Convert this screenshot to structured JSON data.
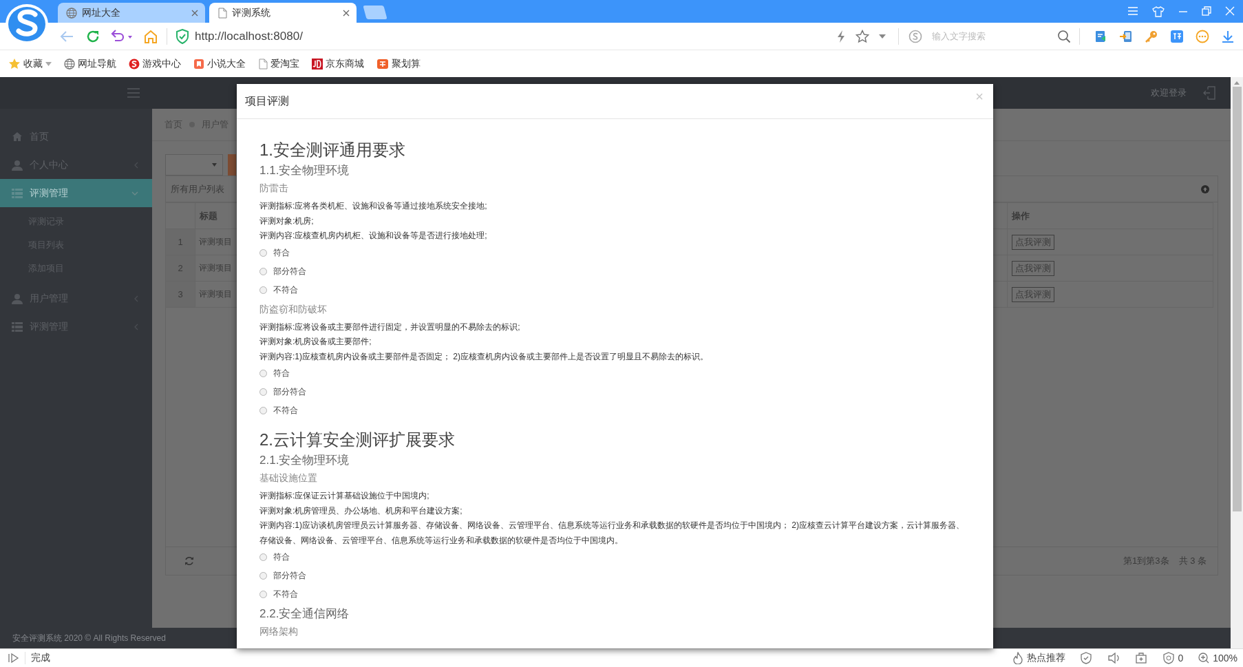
{
  "browser": {
    "tabs": [
      {
        "label": "网址大全",
        "selected": false
      },
      {
        "label": "评测系统",
        "selected": true
      }
    ],
    "address": "http://localhost:8080/",
    "search": {
      "placeholder": "输入文字搜索"
    },
    "bookmarks": [
      {
        "label": "收藏",
        "kind": "favorites"
      },
      {
        "label": "网址导航",
        "kind": "globe"
      },
      {
        "label": "游戏中心",
        "kind": "game"
      },
      {
        "label": "小说大全",
        "kind": "novel"
      },
      {
        "label": "爱淘宝",
        "kind": "page"
      },
      {
        "label": "京东商城",
        "kind": "shop"
      },
      {
        "label": "聚划算",
        "kind": "deal"
      }
    ]
  },
  "app": {
    "header": {
      "welcome": "欢迎登录"
    },
    "sidebar": {
      "items": [
        {
          "label": "首页",
          "kind": "home",
          "selected": false
        },
        {
          "label": "个人中心",
          "kind": "user",
          "selected": false,
          "expanded": false
        },
        {
          "label": "评测管理",
          "kind": "list",
          "selected": true,
          "expanded": true,
          "children": [
            {
              "label": "评测记录"
            },
            {
              "label": "项目列表"
            },
            {
              "label": "添加项目"
            }
          ]
        },
        {
          "label": "用户管理",
          "kind": "user",
          "selected": false,
          "expanded": false
        },
        {
          "label": "评测管理",
          "kind": "list",
          "selected": false,
          "expanded": false
        }
      ]
    },
    "breadcrumb": [
      "首页",
      "用户管"
    ],
    "panel": {
      "title": "所有用户列表",
      "columns": [
        "标题",
        "操作"
      ],
      "rows": [
        {
          "number": "1",
          "title": "评测项目",
          "action": "点我评测"
        },
        {
          "number": "2",
          "title": "评测项目",
          "action": "点我评测"
        },
        {
          "number": "3",
          "title": "评测项目",
          "action": "点我评测"
        }
      ],
      "pagination": {
        "range": "第1到第3条",
        "total": "共 3 条"
      }
    },
    "footer": "安全评测系统 2020 © All Rights Reserved"
  },
  "modal": {
    "title": "项目评测",
    "close": "×",
    "sections": [
      {
        "heading": "1.安全测评通用要求",
        "subsections": [
          {
            "heading": "1.1.安全物理环境",
            "items": [
              {
                "name": "防雷击",
                "lines": [
                  "评测指标:应将各类机柜、设施和设备等通过接地系统安全接地;",
                  "评测对象:机房;",
                  "评测内容:应核查机房内机柜、设施和设备等是否进行接地处理;"
                ],
                "options": [
                  {
                    "label": "符合",
                    "selected": false
                  },
                  {
                    "label": "部分符合",
                    "selected": false
                  },
                  {
                    "label": "不符合",
                    "selected": false
                  }
                ]
              },
              {
                "name": "防盗窃和防破坏",
                "lines": [
                  "评测指标:应将设备或主要部件进行固定，并设置明显的不易除去的标识;",
                  "评测对象:机房设备或主要部件;",
                  "评测内容:1)应核查机房内设备或主要部件是否固定； 2)应核查机房内设备或主要部件上是否设置了明显且不易除去的标识。"
                ],
                "options": [
                  {
                    "label": "符合",
                    "selected": false
                  },
                  {
                    "label": "部分符合",
                    "selected": false
                  },
                  {
                    "label": "不符合",
                    "selected": false
                  }
                ]
              }
            ]
          }
        ]
      },
      {
        "heading": "2.云计算安全测评扩展要求",
        "subsections": [
          {
            "heading": "2.1.安全物理环境",
            "items": [
              {
                "name": "基础设施位置",
                "lines": [
                  "评测指标:应保证云计算基础设施位于中国境内;",
                  "评测对象:机房管理员、办公场地、机房和平台建设方案;",
                  "评测内容:1)应访谈机房管理员云计算服务器、存储设备、网络设备、云管理平台、信息系统等运行业务和承载数据的软硬件是否均位于中国境内； 2)应核查云计算平台建设方案，云计算服务器、存储设备、网络设备、云管理平台、信息系统等运行业务和承载数据的软硬件是否均位于中国境内。"
                ],
                "options": [
                  {
                    "label": "符合",
                    "selected": false
                  },
                  {
                    "label": "部分符合",
                    "selected": false
                  },
                  {
                    "label": "不符合",
                    "selected": false
                  }
                ]
              }
            ]
          },
          {
            "heading": "2.2.安全通信网络",
            "items": [
              {
                "name": "网络架构"
              }
            ]
          }
        ]
      }
    ]
  },
  "status_bar": {
    "status": "完成",
    "hot": "热点推荐",
    "ad_count": "0",
    "zoom": "100%"
  }
}
